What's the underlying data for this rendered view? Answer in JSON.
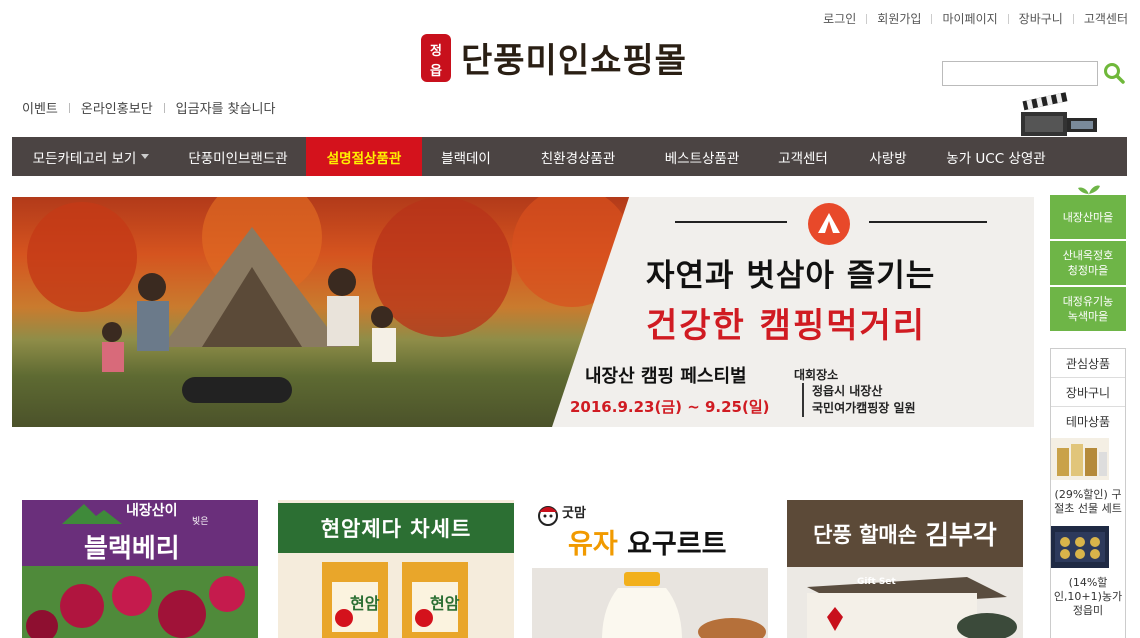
{
  "top_links": [
    "로그인",
    "회원가입",
    "마이페이지",
    "장바구니",
    "고객센터"
  ],
  "logo": {
    "seal_glyphs": [
      "정",
      "읍"
    ],
    "text": "단풍미인쇼핑몰",
    "seal_color": "#c8101c"
  },
  "search": {
    "value": "",
    "icon": "search-icon",
    "icon_color": "#6fb83a"
  },
  "sub_links": [
    "이벤트",
    "온라인홍보단",
    "입금자를 찾습니다"
  ],
  "nav": {
    "items": [
      {
        "label": "모든카테고리 보기",
        "has_caret": true
      },
      {
        "label": "단풍미인브랜드관"
      },
      {
        "label": "설명절상품관",
        "active": true
      },
      {
        "label": "블랙데이"
      },
      {
        "label": "친환경상품관"
      },
      {
        "label": "베스트상품관"
      },
      {
        "label": "고객센터"
      },
      {
        "label": "사랑방"
      },
      {
        "label": "농가 UCC 상영관"
      }
    ],
    "bg_color": "#4b4443",
    "active_color": "#d4121c"
  },
  "banner": {
    "headline1": "자연과 벗삼아 즐기는",
    "headline2": "건강한 캠핑먹거리",
    "festival": "내장산 캠핑 페스티벌",
    "date": "2016.9.23(금) ~ 9.25(일)",
    "venue_label": "대회장소",
    "venue_lines": [
      "정읍시 내장산",
      "국민여가캠핑장 일원"
    ],
    "icon": "tent-icon"
  },
  "sidebar": {
    "villages": [
      "내장산마을",
      "산내옥정호 청정마을",
      "대정유기농 녹색마을"
    ],
    "menu": [
      "관심상품",
      "장바구니"
    ],
    "theme_title": "테마상품",
    "theme_items": [
      {
        "caption": "(29%할인) 구절초 선물 세트"
      },
      {
        "caption": "(14%할인,10+1)농가 정읍미"
      }
    ],
    "green": "#6eb547"
  },
  "cards": {
    "c1": {
      "small": "내장산이",
      "small2": "빚은",
      "title": "블랙베리"
    },
    "c2": {
      "title": "현암제다 차세트",
      "pack_text": "현암"
    },
    "c3": {
      "brand": "굿맘",
      "title_hl": "유자",
      "title_rest": " 요구르트"
    },
    "c4": {
      "title": "단풍 할매손",
      "title_em": "김부각",
      "box_label": "Gift Set"
    }
  }
}
